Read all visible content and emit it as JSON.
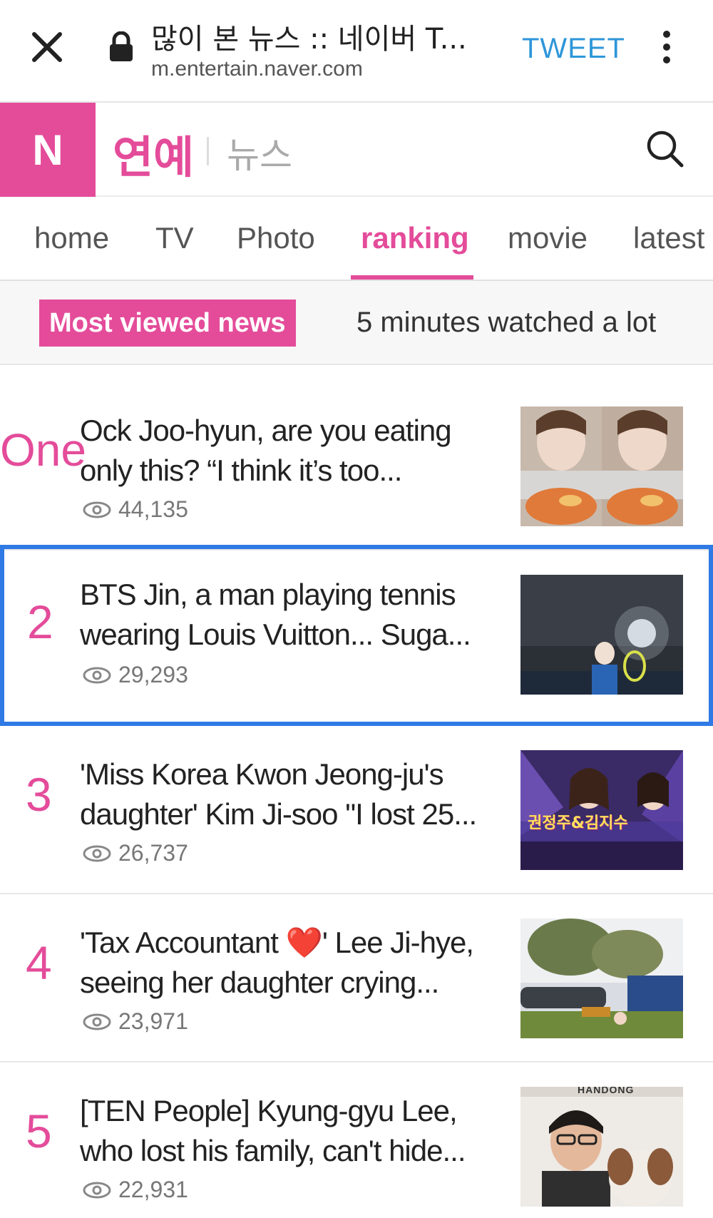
{
  "browser": {
    "tab_title": "많이 본 뉴스 :: 네이버 T...",
    "url": "m.entertain.naver.com",
    "tweet_label": "TWEET"
  },
  "header": {
    "logo": "N",
    "section": "연예",
    "subsection": "뉴스"
  },
  "nav": {
    "items": [
      "home",
      "TV",
      "Photo",
      "ranking",
      "movie",
      "latest"
    ],
    "active": "ranking"
  },
  "ranking": {
    "badge": "Most viewed news",
    "note": "5 minutes watched a lot"
  },
  "news": [
    {
      "rank": "One",
      "title": "Ock Joo-hyun, are you eating only this? “I think it’s too...",
      "views": "44,135"
    },
    {
      "rank": "2",
      "title": "BTS Jin, a man playing tennis wearing Louis Vuitton... Suga...",
      "views": "29,293"
    },
    {
      "rank": "3",
      "title": "'Miss Korea Kwon Jeong-ju's daughter' Kim Ji-soo \"I lost 25...",
      "views": "26,737"
    },
    {
      "rank": "4",
      "title": "'Tax Accountant ❤️' Lee Ji-hye, seeing her daughter crying...",
      "views": "23,971"
    },
    {
      "rank": "5",
      "title": "[TEN People] Kyung-gyu Lee, who lost his family, can't hide...",
      "views": "22,931"
    }
  ],
  "thumb_captions": {
    "item3": "권정주&김지수",
    "item5": "HANDONG"
  },
  "colors": {
    "brand": "#e44c9a",
    "highlight_border": "#2f7ae5",
    "tweet": "#2e96d8"
  }
}
